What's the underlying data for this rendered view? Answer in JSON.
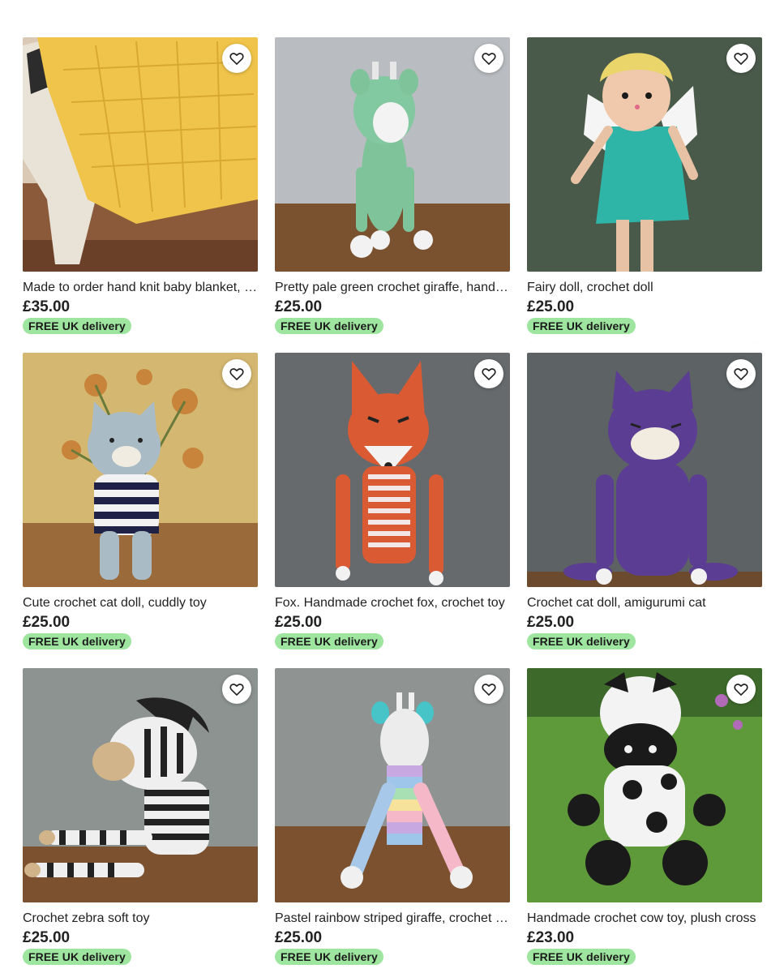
{
  "listings": [
    {
      "title": "Made to order hand knit baby blanket, yellow",
      "price": "£35.00",
      "badge": "FREE UK delivery",
      "image": "yellow-blanket"
    },
    {
      "title": "Pretty pale green crochet giraffe, handmade",
      "price": "£25.00",
      "badge": "FREE UK delivery",
      "image": "green-giraffe"
    },
    {
      "title": "Fairy doll, crochet doll",
      "price": "£25.00",
      "badge": "FREE UK delivery",
      "image": "fairy-doll"
    },
    {
      "title": "Cute crochet cat doll, cuddly toy",
      "price": "£25.00",
      "badge": "FREE UK delivery",
      "image": "blue-cat"
    },
    {
      "title": "Fox. Handmade crochet fox, crochet toy",
      "price": "£25.00",
      "badge": "FREE UK delivery",
      "image": "fox"
    },
    {
      "title": "Crochet cat doll, amigurumi cat",
      "price": "£25.00",
      "badge": "FREE UK delivery",
      "image": "purple-cat"
    },
    {
      "title": "Crochet zebra soft toy",
      "price": "£25.00",
      "badge": "FREE UK delivery",
      "image": "zebra"
    },
    {
      "title": "Pastel rainbow striped giraffe, crochet toy",
      "price": "£25.00",
      "badge": "FREE UK delivery",
      "image": "rainbow-giraffe"
    },
    {
      "title": "Handmade crochet cow toy, plush cross",
      "price": "£23.00",
      "badge": "FREE UK delivery",
      "image": "cow"
    }
  ],
  "icons": {
    "favorite": "heart-outline-icon"
  },
  "colors": {
    "badge_bg": "#9ee59f",
    "text": "#222222"
  }
}
